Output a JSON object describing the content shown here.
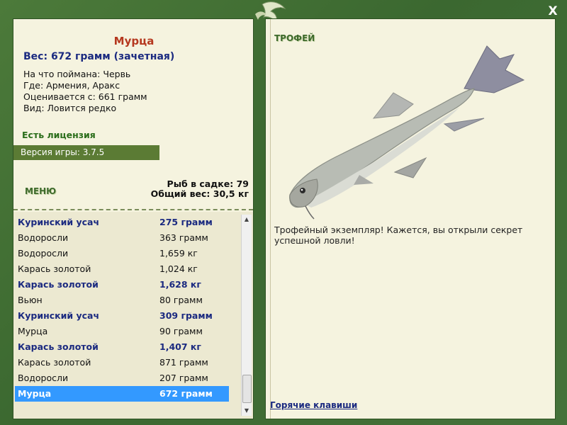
{
  "window": {
    "close_label": "X"
  },
  "fish": {
    "name": "Мурца",
    "weight": "Вес: 672 грамм (зачетная)",
    "bait": "На что поймана: Червь",
    "place": "Где: Армения, Аракс",
    "estimate": "Оценивается с: 661 грамм",
    "kind": "Вид: Ловится редко"
  },
  "license": "Есть лицензия",
  "version": "Версия игры: 3.7.5",
  "menu_label": "МЕНЮ",
  "stats": {
    "count": "Рыб в садке: 79",
    "total_weight": "Общий вес: 30,5 кг"
  },
  "catches": [
    {
      "name": "Куринский усач",
      "weight": "275 грамм",
      "bold": true
    },
    {
      "name": "Водоросли",
      "weight": "363 грамм",
      "bold": false
    },
    {
      "name": "Водоросли",
      "weight": "1,659 кг",
      "bold": false
    },
    {
      "name": "Карась золотой",
      "weight": "1,024 кг",
      "bold": false
    },
    {
      "name": "Карась золотой",
      "weight": "1,628 кг",
      "bold": true
    },
    {
      "name": "Вьюн",
      "weight": "80 грамм",
      "bold": false
    },
    {
      "name": "Куринский усач",
      "weight": "309 грамм",
      "bold": true
    },
    {
      "name": "Мурца",
      "weight": "90 грамм",
      "bold": false
    },
    {
      "name": "Карась золотой",
      "weight": "1,407 кг",
      "bold": true
    },
    {
      "name": "Карась золотой",
      "weight": "871 грамм",
      "bold": false
    },
    {
      "name": "Водоросли",
      "weight": "207 грамм",
      "bold": false
    },
    {
      "name": "Мурца",
      "weight": "672 грамм",
      "bold": true,
      "selected": true
    }
  ],
  "trophy": {
    "label": "ТРОФЕЙ",
    "text": "Трофейный экземпляр! Кажется, вы открыли секрет успешной ловли!"
  },
  "hotkeys_label": "Горячие клавиши",
  "colors": {
    "frame": "#3d6a2f",
    "panel": "#f5f3df",
    "accent_name": "#b5381f",
    "bold_text": "#1b2a80",
    "selection": "#3399ff",
    "version_bar": "#5b7b34"
  }
}
